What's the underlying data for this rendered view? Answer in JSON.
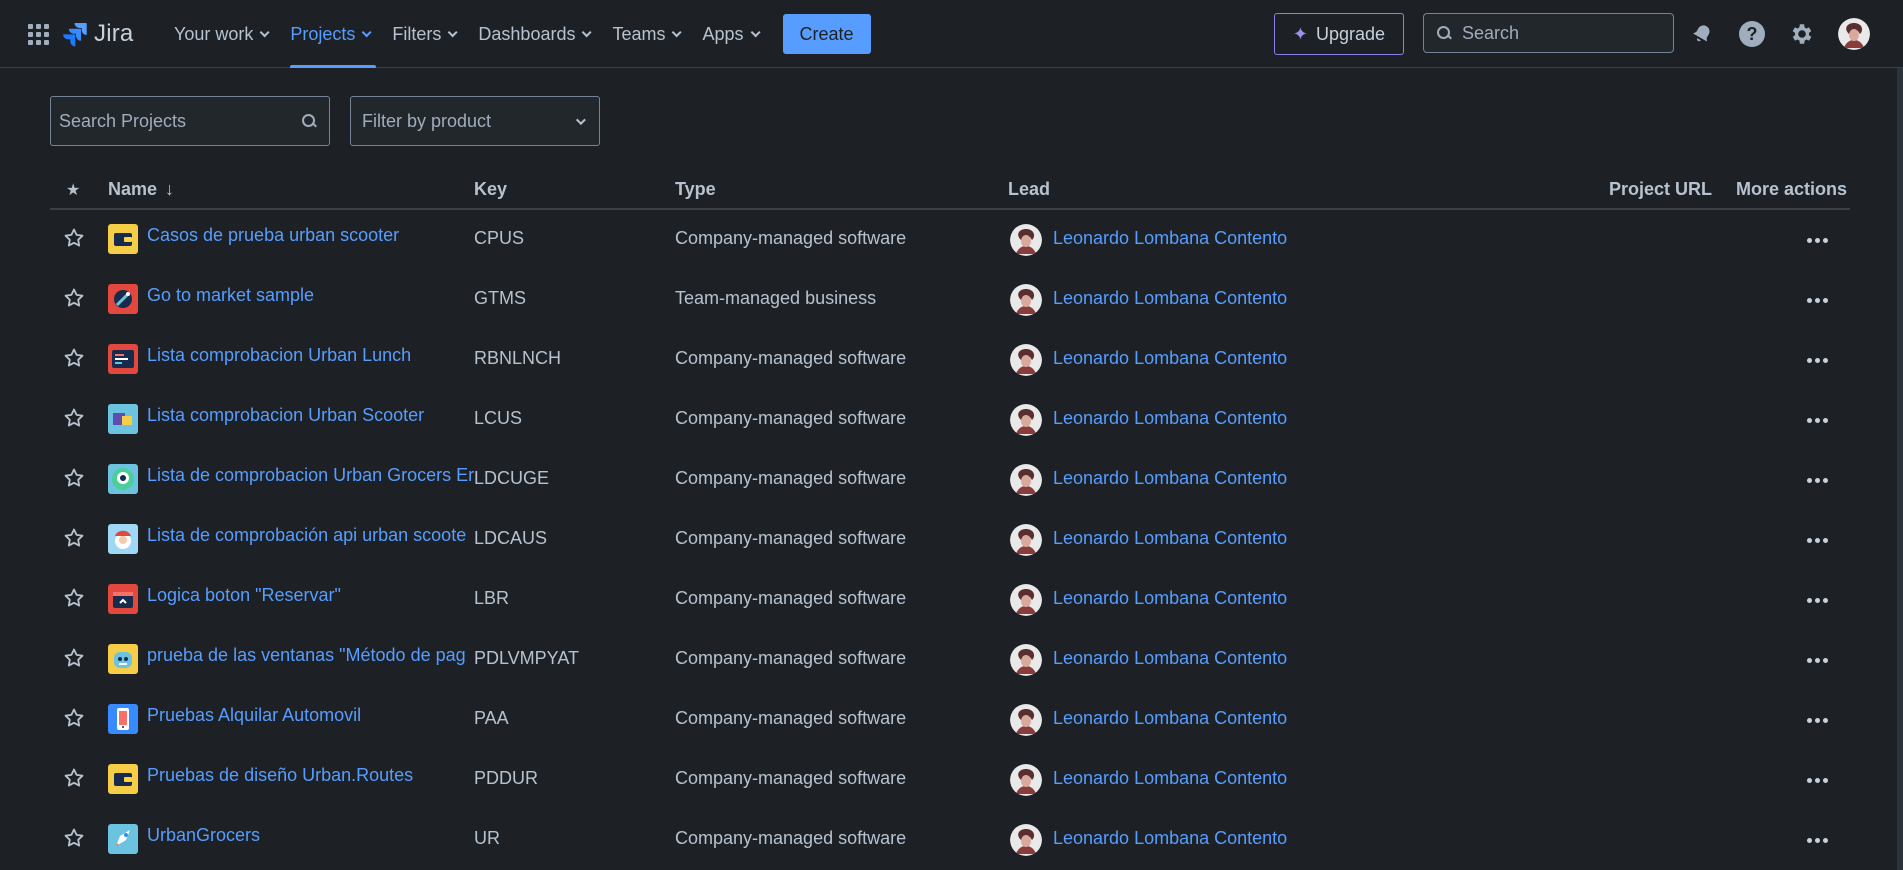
{
  "nav": {
    "logo_text": "Jira",
    "items": [
      {
        "label": "Your work",
        "active": false
      },
      {
        "label": "Projects",
        "active": true
      },
      {
        "label": "Filters",
        "active": false
      },
      {
        "label": "Dashboards",
        "active": false
      },
      {
        "label": "Teams",
        "active": false
      },
      {
        "label": "Apps",
        "active": false
      }
    ],
    "create_label": "Create",
    "upgrade_label": "Upgrade",
    "search_placeholder": "Search",
    "icons": [
      "app-switcher-icon",
      "notifications-icon",
      "help-icon",
      "settings-icon"
    ],
    "accent_color": "#579dff"
  },
  "filters": {
    "search_placeholder": "Search Projects",
    "product_placeholder": "Filter by product"
  },
  "table": {
    "headers": {
      "name": "Name",
      "key": "Key",
      "type": "Type",
      "lead": "Lead",
      "url": "Project URL",
      "more": "More actions"
    },
    "rows": [
      {
        "name": "Casos de prueba urban scooter",
        "key": "CPUS",
        "type": "Company-managed software",
        "lead": "Leonardo Lombana Contento",
        "icon": "wallet-icon",
        "icon_bg": "#f5cd47"
      },
      {
        "name": "Go to market sample",
        "key": "GTMS",
        "type": "Team-managed business",
        "lead": "Leonardo Lombana Contento",
        "icon": "rocket-target-icon",
        "icon_bg": "#e2483d"
      },
      {
        "name": "Lista comprobacion Urban Lunch",
        "key": "RBNLNCH",
        "type": "Company-managed software",
        "lead": "Leonardo Lombana Contento",
        "icon": "board-icon",
        "icon_bg": "#e2483d"
      },
      {
        "name": "Lista comprobacion Urban Scooter",
        "key": "LCUS",
        "type": "Company-managed software",
        "lead": "Leonardo Lombana Contento",
        "icon": "cards-icon",
        "icon_bg": "#4bce97"
      },
      {
        "name": "Lista de comprobacion Urban Grocers Er",
        "key": "LDCUGE",
        "type": "Company-managed software",
        "lead": "Leonardo Lombana Contento",
        "icon": "robot-icon",
        "icon_bg": "#6cc3e0"
      },
      {
        "name": "Lista de comprobación api urban scoote",
        "key": "LDCAUS",
        "type": "Company-managed software",
        "lead": "Leonardo Lombana Contento",
        "icon": "santa-icon",
        "icon_bg": "#9fd8f5"
      },
      {
        "name": "Logica boton \"Reservar\"",
        "key": "LBR",
        "type": "Company-managed software",
        "lead": "Leonardo Lombana Contento",
        "icon": "calendar-icon",
        "icon_bg": "#e2483d"
      },
      {
        "name": "prueba de las ventanas \"Método de pag",
        "key": "PDLVMPYAT",
        "type": "Company-managed software",
        "lead": "Leonardo Lombana Contento",
        "icon": "monster-icon",
        "icon_bg": "#f5cd47"
      },
      {
        "name": "Pruebas Alquilar Automovil",
        "key": "PAA",
        "type": "Company-managed software",
        "lead": "Leonardo Lombana Contento",
        "icon": "phone-icon",
        "icon_bg": "#388bff"
      },
      {
        "name": "Pruebas de diseño Urban.Routes",
        "key": "PDDUR",
        "type": "Company-managed software",
        "lead": "Leonardo Lombana Contento",
        "icon": "wallet-icon",
        "icon_bg": "#f5cd47"
      },
      {
        "name": "UrbanGrocers",
        "key": "UR",
        "type": "Company-managed software",
        "lead": "Leonardo Lombana Contento",
        "icon": "rocket-icon",
        "icon_bg": "#6cc3e0"
      }
    ]
  }
}
